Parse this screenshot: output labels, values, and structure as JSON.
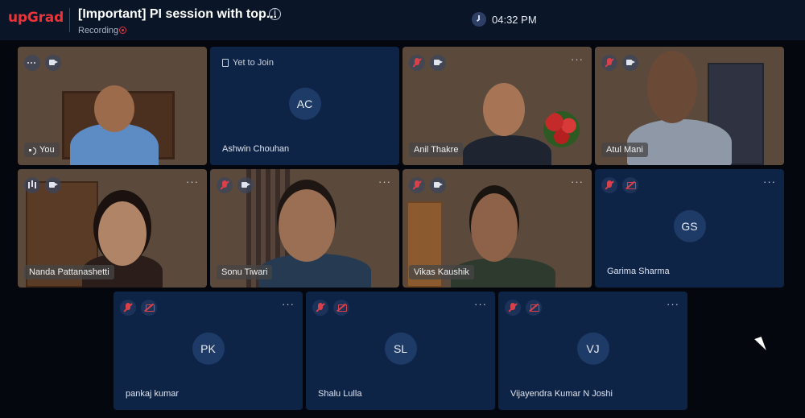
{
  "header": {
    "brand": "upGrad",
    "title": "[Important] PI session with top...",
    "recording_label": "Recording",
    "time": "04:32 PM"
  },
  "participants": [
    {
      "name": "You",
      "video": true
    },
    {
      "name": "Ashwin Chouhan",
      "initials": "AC",
      "status": "Yet to Join"
    },
    {
      "name": "Anil Thakre",
      "video": true
    },
    {
      "name": "Atul Mani",
      "video": true
    },
    {
      "name": "Nanda Pattanashetti",
      "video": true
    },
    {
      "name": "Sonu Tiwari",
      "video": true
    },
    {
      "name": "Vikas Kaushik",
      "video": true
    },
    {
      "name": "Garima Sharma",
      "initials": "GS"
    },
    {
      "name": "pankaj kumar",
      "initials": "PK"
    },
    {
      "name": "Shalu Lulla",
      "initials": "SL"
    },
    {
      "name": "Vijayendra Kumar N Joshi",
      "initials": "VJ"
    }
  ],
  "icons": {
    "more": "more-dots-icon",
    "mic_muted": "mic-muted-icon",
    "camera": "camera-icon",
    "camera_off": "camera-off-icon",
    "info": "info-icon",
    "clock": "clock-icon"
  },
  "colors": {
    "brand_red": "#ee3338",
    "header_bg": "#0a1628",
    "tile_bg": "#0e2447",
    "muted_red": "#d8404a"
  }
}
